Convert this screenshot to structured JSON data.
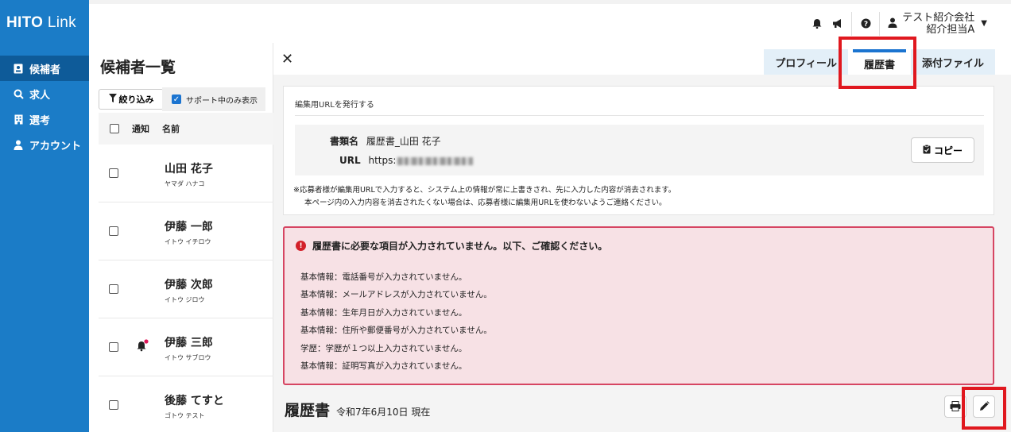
{
  "app": {
    "logo_bold": "HITO",
    "logo_light": "Link",
    "brand_color": "#1b7cc7"
  },
  "sidebar": {
    "items": [
      {
        "label": "候補者",
        "icon": "id-card-icon",
        "active": true
      },
      {
        "label": "求人",
        "icon": "search-icon",
        "active": false
      },
      {
        "label": "選考",
        "icon": "building-icon",
        "active": false
      },
      {
        "label": "アカウント",
        "icon": "user-icon",
        "active": false
      }
    ]
  },
  "topbar": {
    "icons": [
      "bell-icon",
      "megaphone-icon",
      "help-icon",
      "user-icon"
    ],
    "company": "テスト紹介会社",
    "user": "紹介担当A"
  },
  "candidates": {
    "title": "候補者一覧",
    "filter_label": "絞り込み",
    "support_only_label": "サポート中のみ表示",
    "support_only_checked": true,
    "columns": {
      "notify": "通知",
      "name": "名前"
    },
    "rows": [
      {
        "name": "山田 花子",
        "kana": "ヤマダ ハナコ",
        "notify": false
      },
      {
        "name": "伊藤 一郎",
        "kana": "イトウ イチロウ",
        "notify": false
      },
      {
        "name": "伊藤 次郎",
        "kana": "イトウ ジロウ",
        "notify": false
      },
      {
        "name": "伊藤 三郎",
        "kana": "イトウ サブロウ",
        "notify": true
      },
      {
        "name": "後藤 てすと",
        "kana": "ゴトウ テスト",
        "notify": false
      }
    ]
  },
  "detail": {
    "tabs": [
      {
        "label": "プロフィール",
        "active": false
      },
      {
        "label": "履歴書",
        "active": true
      },
      {
        "label": "添付ファイル",
        "active": false
      }
    ],
    "edit_url": {
      "section_title": "編集用URLを発行する",
      "doc_name_label": "書類名",
      "doc_name_value": "履歴書_山田 花子",
      "url_label": "URL",
      "url_value": "https:",
      "copy_label": "コピー",
      "note_line1": "※応募者様が編集用URLで入力すると、システム上の情報が常に上書きされ、先に入力した内容が消去されます。",
      "note_line2": "本ページ内の入力内容を消去されたくない場合は、応募者様に編集用URLを使わないようご連絡ください。"
    },
    "alert": {
      "title": "履歴書に必要な項目が入力されていません。以下、ご確認ください。",
      "color": "#d32029",
      "items": [
        "基本情報：電話番号が入力されていません。",
        "基本情報：メールアドレスが入力されていません。",
        "基本情報：生年月日が入力されていません。",
        "基本情報：住所や郵便番号が入力されていません。",
        "学歴：学歴が１つ以上入力されていません。",
        "基本情報：証明写真が入力されていません。"
      ]
    },
    "resume": {
      "title": "履歴書",
      "date": "令和7年6月10日 現在"
    }
  }
}
